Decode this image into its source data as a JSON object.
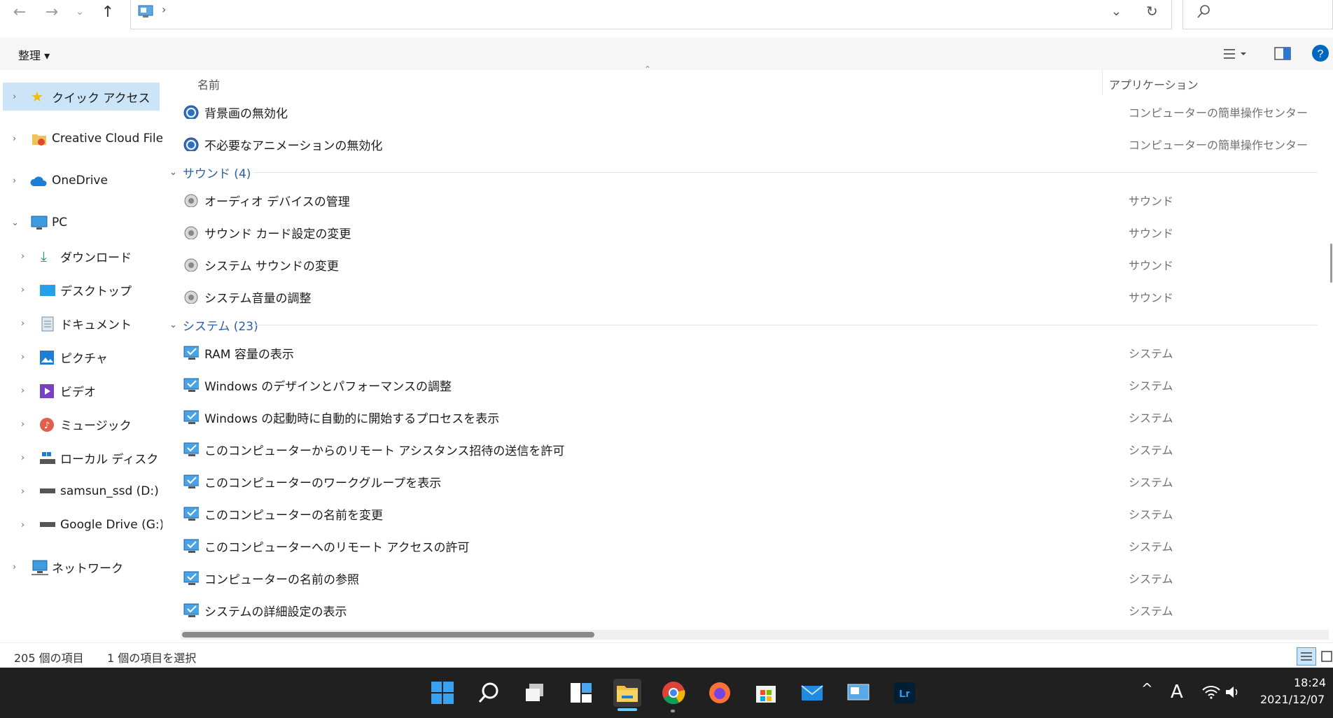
{
  "organize_label": "整理 ▾",
  "nav": {
    "quick_access": "クイック アクセス",
    "creative_cloud": "Creative Cloud Files",
    "onedrive": "OneDrive",
    "pc": "PC",
    "downloads": "ダウンロード",
    "desktop": "デスクトップ",
    "documents": "ドキュメント",
    "pictures": "ピクチャ",
    "videos": "ビデオ",
    "music": "ミュージック",
    "local_disk": "ローカル ディスク (C:)",
    "samsung": "samsun_ssd (D:)",
    "gdrive": "Google Drive (G:)",
    "network": "ネットワーク"
  },
  "columns": {
    "name": "名前",
    "app": "アプリケーション"
  },
  "rows_top": [
    {
      "name": "背景画の無効化",
      "app": "コンピューターの簡単操作センター"
    },
    {
      "name": "不必要なアニメーションの無効化",
      "app": "コンピューターの簡単操作センター"
    }
  ],
  "group_sound": "サウンド (4)",
  "rows_sound": [
    {
      "name": "オーディオ デバイスの管理",
      "app": "サウンド"
    },
    {
      "name": "サウンド カード設定の変更",
      "app": "サウンド"
    },
    {
      "name": "システム サウンドの変更",
      "app": "サウンド"
    },
    {
      "name": "システム音量の調整",
      "app": "サウンド"
    }
  ],
  "group_system": "システム (23)",
  "rows_system": [
    {
      "name": "RAM 容量の表示",
      "app": "システム"
    },
    {
      "name": "Windows のデザインとパフォーマンスの調整",
      "app": "システム"
    },
    {
      "name": "Windows の起動時に自動的に開始するプロセスを表示",
      "app": "システム"
    },
    {
      "name": "このコンピューターからのリモート アシスタンス招待の送信を許可",
      "app": "システム"
    },
    {
      "name": "このコンピューターのワークグループを表示",
      "app": "システム"
    },
    {
      "name": "このコンピューターの名前を変更",
      "app": "システム"
    },
    {
      "name": "このコンピューターへのリモート アクセスの許可",
      "app": "システム"
    },
    {
      "name": "コンピューターの名前の参照",
      "app": "システム"
    },
    {
      "name": "システムの詳細設定の表示",
      "app": "システム"
    }
  ],
  "status": {
    "count": "205 個の項目",
    "selected": "1 個の項目を選択"
  },
  "clock": {
    "time": "18:24",
    "date": "2021/12/07"
  },
  "ime": "A",
  "accent": "#0067c0",
  "hscroll_thumb_fraction": 0.36
}
